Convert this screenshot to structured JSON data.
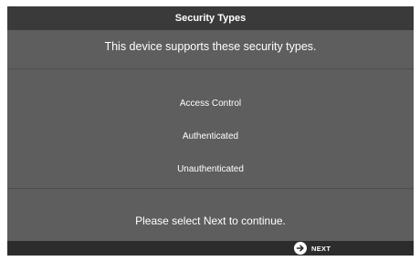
{
  "header": {
    "title": "Security Types"
  },
  "main": {
    "description": "This device supports these security types.",
    "security_types": [
      {
        "label": "Access Control"
      },
      {
        "label": "Authenticated"
      },
      {
        "label": "Unauthenticated"
      }
    ],
    "prompt": "Please select Next to continue."
  },
  "footer": {
    "next_label": "NEXT",
    "next_icon": "arrow-right-circle-icon"
  },
  "colors": {
    "background": "#5e5e5e",
    "title_bar": "#3a3a3a",
    "footer": "#2c2c2c",
    "text": "#ffffff"
  }
}
